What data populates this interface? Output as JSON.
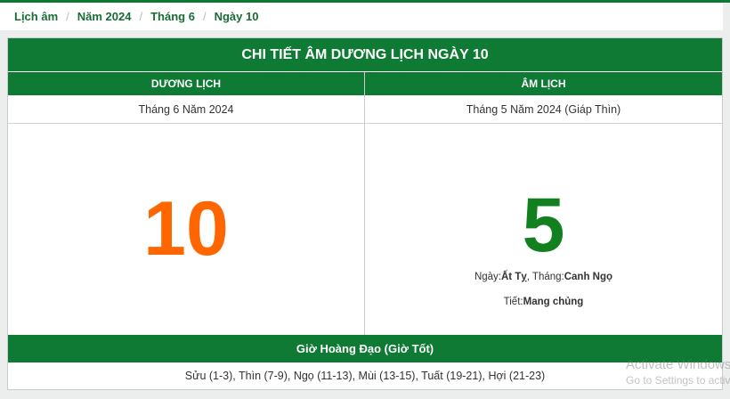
{
  "colors": {
    "brand_green": "#0f7a33",
    "solar_day": "#ff6600",
    "lunar_day": "#12801f"
  },
  "breadcrumb": {
    "items": [
      "Lịch âm",
      "Năm 2024",
      "Tháng 6",
      "Ngày 10"
    ],
    "separator": "/"
  },
  "card": {
    "title": "CHI TIẾT ÂM DƯƠNG LỊCH NGÀY 10",
    "solar": {
      "header": "DƯƠNG LỊCH",
      "month_year": "Tháng 6 Năm 2024",
      "day": "10"
    },
    "lunar": {
      "header": "ÂM LỊCH",
      "month_year": "Tháng 5 Năm 2024 (Giáp Thìn)",
      "day": "5",
      "day_label": "Ngày: ",
      "day_canchi": "Ất Tỵ",
      "month_label": ", Tháng: ",
      "month_canchi": "Canh Ngọ",
      "solar_term_label": "Tiết: ",
      "solar_term": "Mang chủng"
    },
    "good_hours": {
      "title": "Giờ Hoàng Đạo (Giờ Tốt)",
      "list": "Sửu (1-3), Thìn (7-9), Ngọ (11-13), Mùi (13-15), Tuất (19-21), Hợi (21-23)"
    }
  },
  "watermark": {
    "line1": "Activate Windows",
    "line2": "Go to Settings to activate Windows."
  }
}
